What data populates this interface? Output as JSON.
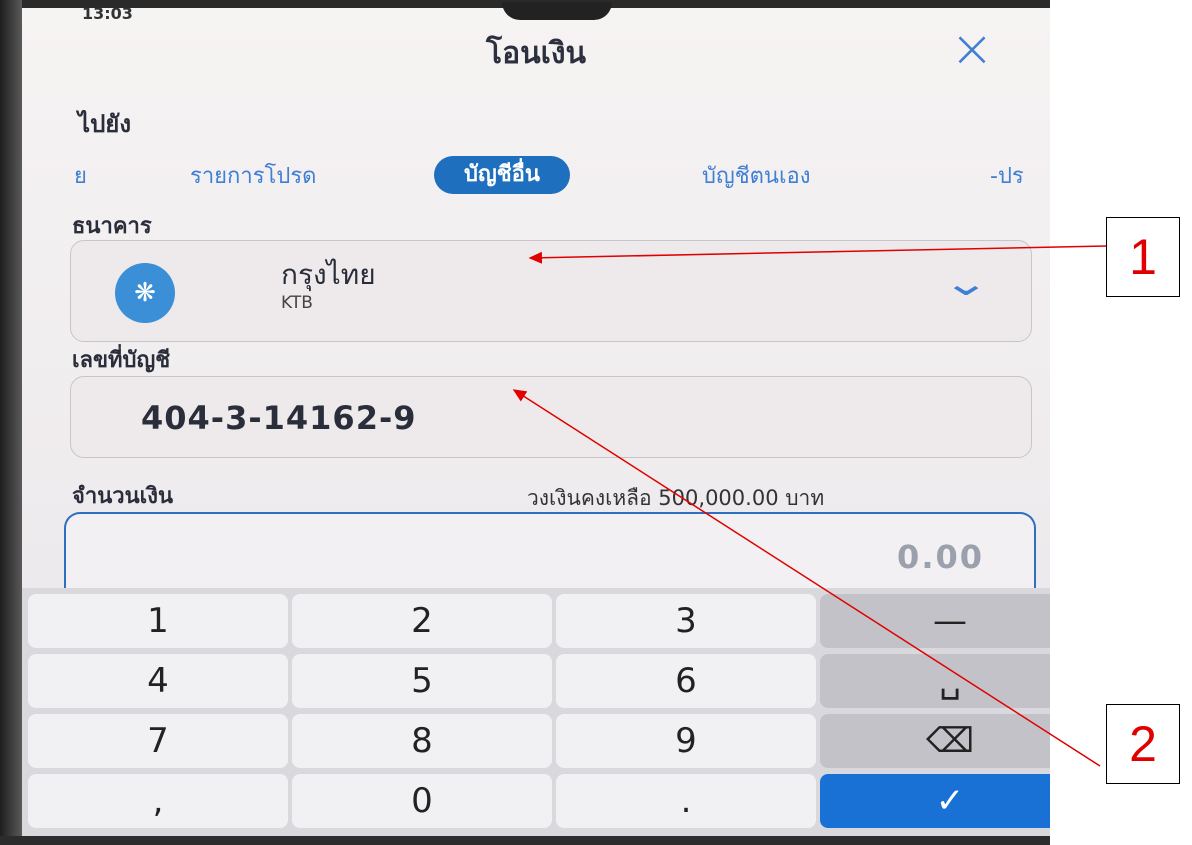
{
  "status_bar": {
    "time": "13:03"
  },
  "header": {
    "title": "โอนเงิน",
    "close_icon": "close-icon"
  },
  "destination": {
    "label": "ไปยัง",
    "tabs": [
      {
        "label": "ย",
        "active": false
      },
      {
        "label": "รายการโปรด",
        "active": false
      },
      {
        "label": "บัญชีอื่น",
        "active": true
      },
      {
        "label": "บัญชีตนเอง",
        "active": false
      },
      {
        "label": "-ปร",
        "active": false
      }
    ]
  },
  "bank": {
    "label": "ธนาคาร",
    "selected_name": "กรุงไทย",
    "selected_code": "KTB",
    "logo_icon": "ktb-bird-logo-icon",
    "dropdown_icon": "chevron-down-icon"
  },
  "account": {
    "label": "เลขที่บัญชี",
    "value": "404-3-14162-9"
  },
  "amount": {
    "label": "จำนวนเงิน",
    "limit_text": "วงเงินคงเหลือ 500,000.00 บาท",
    "value": "0.00"
  },
  "keypad": {
    "keys": [
      "1",
      "2",
      "3",
      "—",
      "4",
      "5",
      "6",
      "␣",
      "7",
      "8",
      "9",
      "⌫",
      ",",
      "0",
      ".",
      "✓"
    ]
  },
  "annotations": {
    "box1": "1",
    "box2": "2"
  },
  "colors": {
    "accent": "#1f6fbf",
    "annotation": "#e00000"
  }
}
